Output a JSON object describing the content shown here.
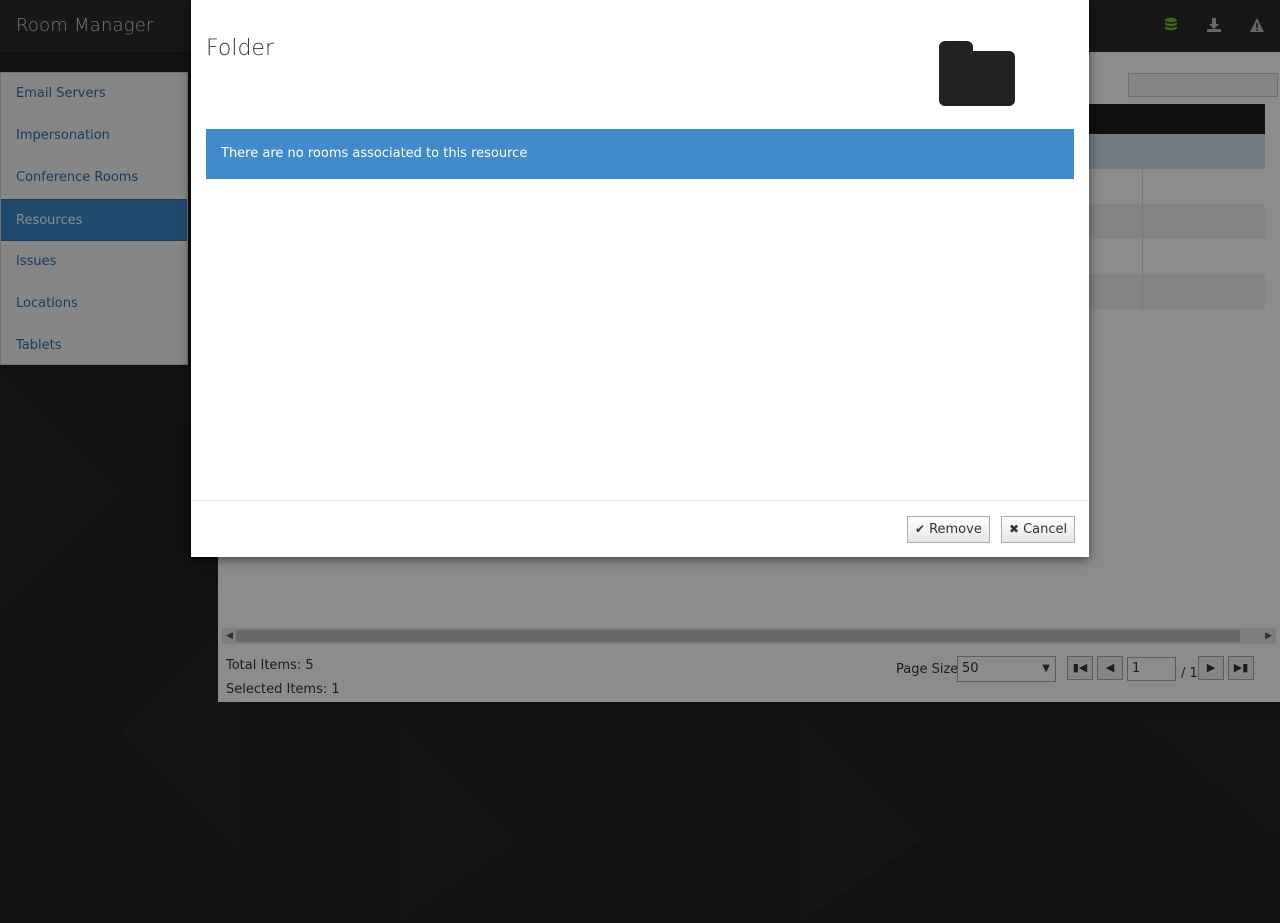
{
  "app": {
    "title": "Room Manager"
  },
  "header_icons": [
    {
      "name": "database-icon",
      "color": "#6fbe2a"
    },
    {
      "name": "download-icon",
      "color": "#bbbbbb"
    },
    {
      "name": "warning-icon",
      "color": "#bbbbbb"
    }
  ],
  "sidebar": {
    "items": [
      {
        "label": "Email Servers",
        "active": false
      },
      {
        "label": "Impersonation",
        "active": false
      },
      {
        "label": "Conference Rooms",
        "active": false
      },
      {
        "label": "Resources",
        "active": true
      },
      {
        "label": "Issues",
        "active": false
      },
      {
        "label": "Locations",
        "active": false
      },
      {
        "label": "Tablets",
        "active": false
      }
    ]
  },
  "grid": {
    "search_placeholder": "",
    "total_items": "Total Items: 5",
    "selected_items": "Selected Items: 1",
    "page_size_label": "Page Size:",
    "page_size_value": "50",
    "page_current": "1",
    "page_total": "/ 1"
  },
  "modal": {
    "title": "Folder",
    "icon": "folder-icon",
    "message": "There are no rooms associated to this resource",
    "remove_label": "Remove",
    "cancel_label": "Cancel"
  },
  "colors": {
    "accent": "#428bca",
    "sidebar_active": "#3a87c8"
  }
}
